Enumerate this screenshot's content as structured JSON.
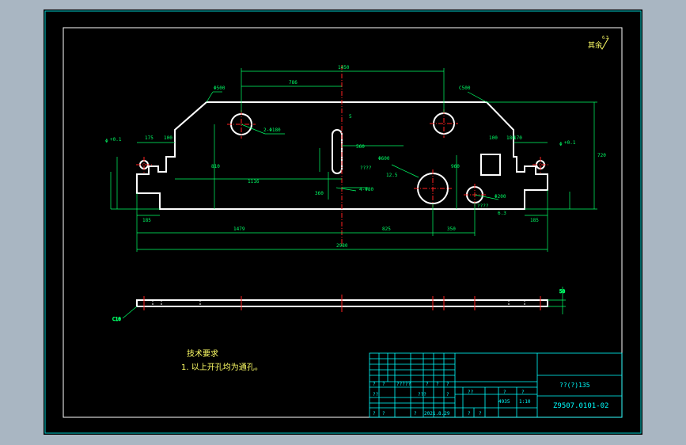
{
  "colors": {
    "background": "#000000",
    "frame": "#ffffff",
    "part": "#ffffff",
    "dimension": "#00ff66",
    "title_block": "#00ffff",
    "centerline": "#ff2020",
    "text": "#ffff66"
  },
  "drawing": {
    "roughness_symbol": "其余",
    "roughness_value": "6.3",
    "front_view_dims": {
      "top_1": "1450",
      "top_2": "786",
      "chamfer_left": "Φ500",
      "chamfer_right": "C500",
      "slot_width": "5",
      "hole_note_left": "2-Φ180",
      "slot_note": "4-Φ80",
      "slot_center": "560",
      "big_hole": "Φ600",
      "big_hole_note": "????",
      "small_hole": "Φ200",
      "small_hole_note": "????",
      "roughness_small": "6.3",
      "roughness_big": "12.5",
      "left_width_1": "175",
      "left_width_2": "100",
      "right_width_1": "100",
      "right_width_2": "170",
      "mid_dim_1": "180",
      "mid_dim_2": "1116",
      "height_1": "810",
      "height_2": "960",
      "height_3": "360",
      "height_total": "720",
      "base_left": "185",
      "base_right": "185",
      "bottom_1": "1479",
      "bottom_2": "825",
      "bottom_3": "350",
      "bottom_total": "2980",
      "left_tol": "+0.1",
      "left_tol_label": "Φ",
      "right_tol": "+0.1",
      "right_tol_label": "Φ"
    },
    "side_view_dims": {
      "thickness": "50",
      "leader": "C10"
    },
    "tech_requirements": {
      "title": "技术要求",
      "item_1": "1. 以上开孔均为通孔。"
    },
    "title_block": {
      "material": "??(?)135",
      "drawing_no": "Z9507.0101-02",
      "scale": "1:10",
      "weight": "4935",
      "date": "2021.8.29",
      "r1": [
        "?",
        "?",
        "?????",
        "?",
        "?",
        "?"
      ],
      "r2": [
        "??",
        "???",
        "??",
        "?",
        "?",
        "?"
      ],
      "r3": [
        "?",
        "?",
        "?",
        "?",
        "?"
      ]
    }
  }
}
